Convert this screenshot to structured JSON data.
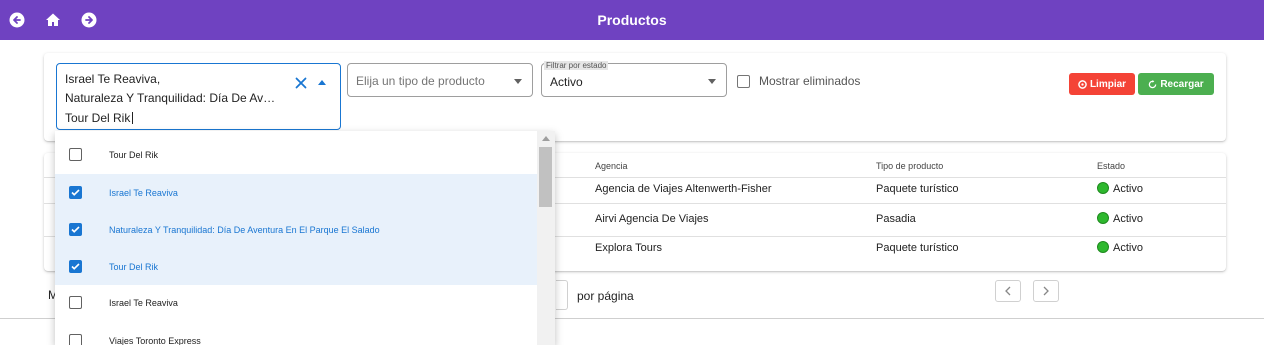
{
  "header": {
    "title": "Productos",
    "back_icon": "arrow-left-circle-icon",
    "home_icon": "home-icon",
    "forward_icon": "arrow-right-circle-icon",
    "bg_color": "#6f42c1"
  },
  "filters": {
    "products_multiselect": {
      "selected_lines": [
        "Israel Te Reaviva,",
        "Naturaleza Y Tranquilidad: Día De Av…"
      ],
      "typed_value": "Tour Del Rik"
    },
    "product_type": {
      "placeholder": "Elija un tipo de producto"
    },
    "status": {
      "label": "Filtrar por estado",
      "value": "Activo"
    },
    "show_deleted": {
      "label": "Mostrar eliminados",
      "checked": false
    },
    "clear_button": {
      "label": "Limpiar",
      "color": "#f44336"
    },
    "reload_button": {
      "label": "Recargar",
      "color": "#4caf50"
    }
  },
  "dropdown_options": [
    {
      "label": "Tour Del Rik",
      "checked": false
    },
    {
      "label": "Israel Te Reaviva",
      "checked": true
    },
    {
      "label": "Naturaleza Y Tranquilidad: Día De Aventura En El Parque El Salado",
      "checked": true
    },
    {
      "label": "Tour Del Rik",
      "checked": true
    },
    {
      "label": "Israel Te Reaviva",
      "checked": false
    },
    {
      "label": "Viajes Toronto Express",
      "checked": false
    }
  ],
  "table": {
    "columns": {
      "agency": "Agencia",
      "product_type": "Tipo de producto",
      "status": "Estado"
    },
    "rows": [
      {
        "agency": "Agencia de Viajes Altenwerth-Fisher",
        "product_type": "Paquete turístico",
        "status": "Activo"
      },
      {
        "agency": "Airvi Agencia De Viajes",
        "product_type": "Pasadia",
        "status": "Activo"
      },
      {
        "agency": "Explora Tours",
        "product_type": "Paquete turístico",
        "status": "Activo"
      }
    ],
    "status_color": "#2eb82e"
  },
  "pagination": {
    "left_fragment": "M",
    "per_page_label": "por página",
    "prev_icon": "chevron-left-icon",
    "next_icon": "chevron-right-icon"
  }
}
